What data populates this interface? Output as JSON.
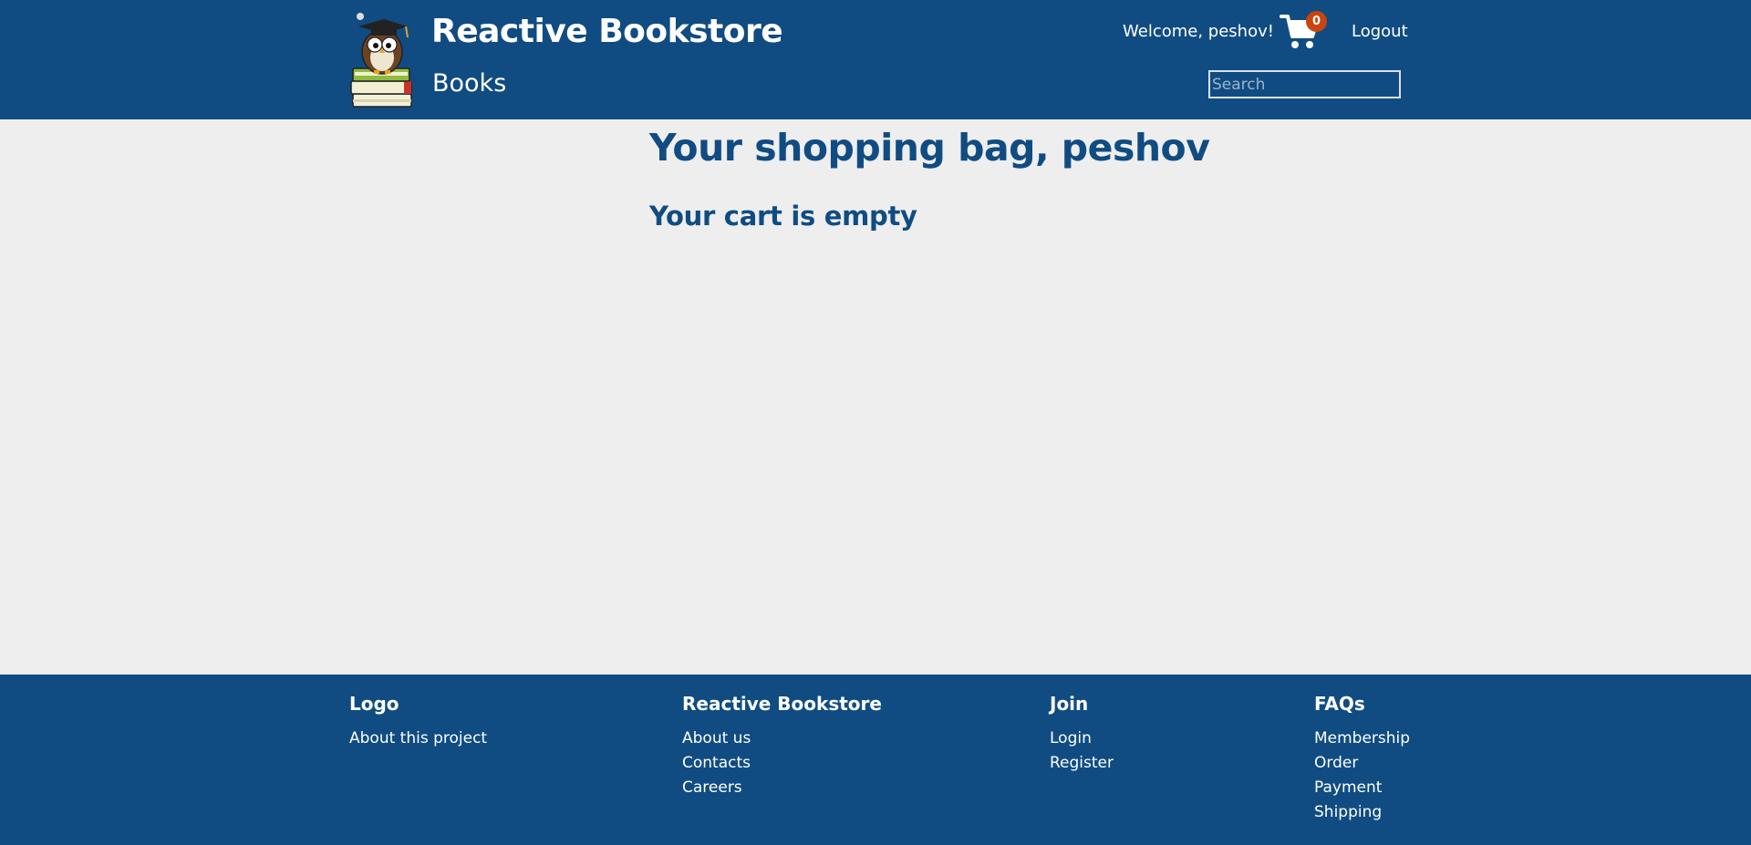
{
  "header": {
    "brand_title": "Reactive Bookstore",
    "nav_books": "Books",
    "welcome": "Welcome, peshov!",
    "cart_count": "0",
    "logout": "Logout",
    "search_placeholder": "Search",
    "colors": {
      "background": "#104c82",
      "badge": "#c8450f"
    }
  },
  "main": {
    "title": "Your shopping bag, peshov",
    "empty_message": "Your cart is empty"
  },
  "footer": {
    "columns": [
      {
        "heading": "Logo",
        "links": [
          "About this project"
        ]
      },
      {
        "heading": "Reactive Bookstore",
        "links": [
          "About us",
          "Contacts",
          "Careers"
        ]
      },
      {
        "heading": "Join",
        "links": [
          "Login",
          "Register"
        ]
      },
      {
        "heading": "FAQs",
        "links": [
          "Membership",
          "Order",
          "Payment",
          "Shipping"
        ]
      }
    ]
  }
}
